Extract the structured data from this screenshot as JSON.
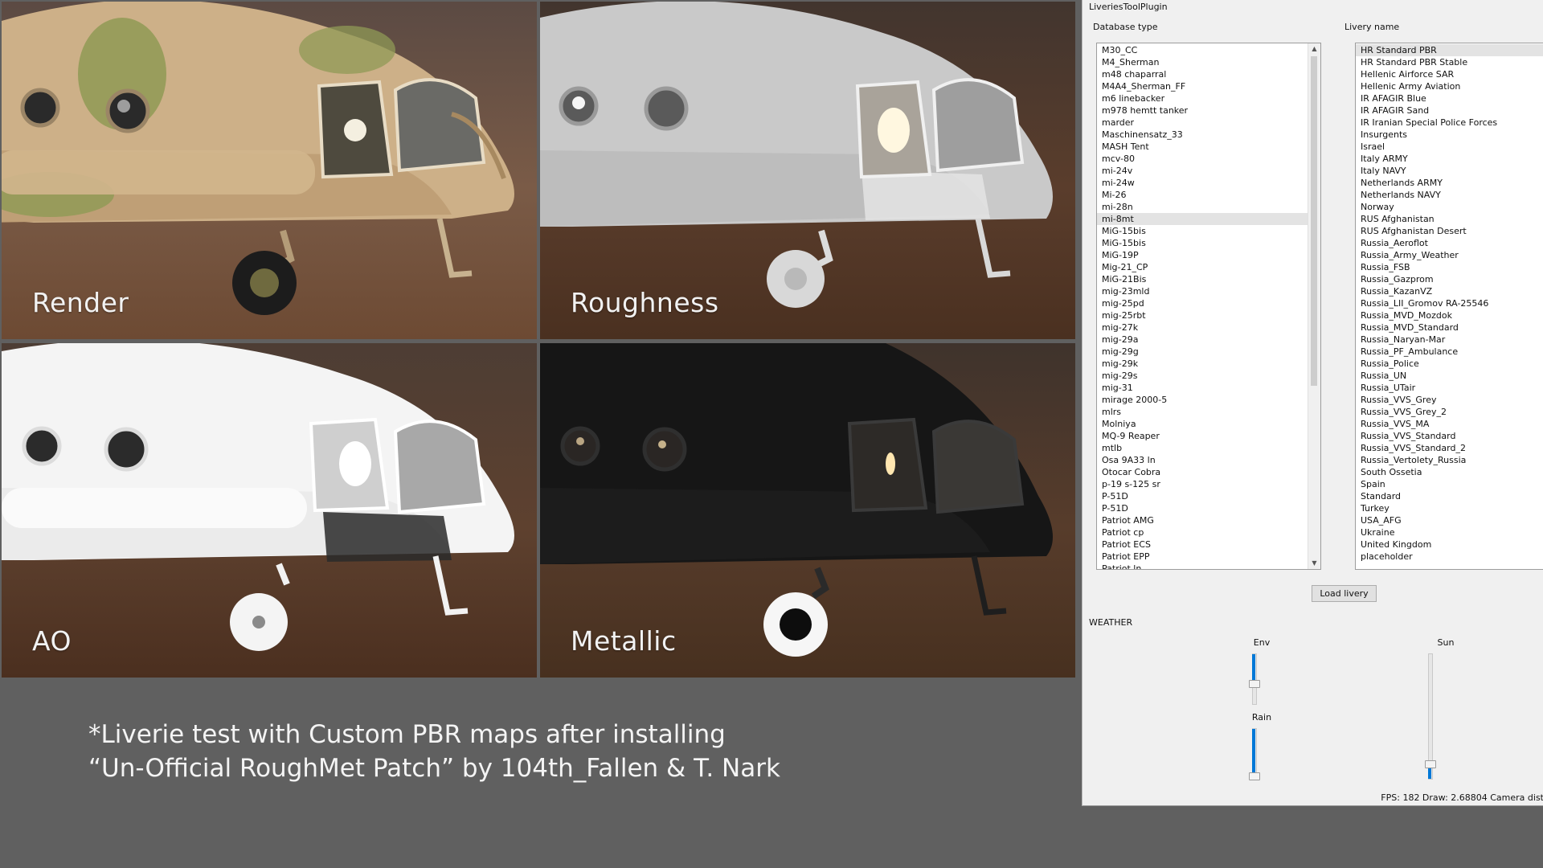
{
  "viewports": [
    {
      "id": "render",
      "label": "Render"
    },
    {
      "id": "roughness",
      "label": "Roughness"
    },
    {
      "id": "ao",
      "label": "AO"
    },
    {
      "id": "metallic",
      "label": "Metallic"
    }
  ],
  "caption": {
    "line1": "*Liverie test with Custom PBR maps after installing",
    "line2": "“Un-Official RoughMet Patch” by 104th_Fallen & T. Nark"
  },
  "plugin": {
    "title": "LiveriesToolPlugin",
    "database_label": "Database type",
    "livery_label": "Livery name",
    "database_items": [
      "M30_CC",
      "M4_Sherman",
      "m48 chaparral",
      "M4A4_Sherman_FF",
      "m6 linebacker",
      "m978 hemtt tanker",
      "marder",
      "Maschinensatz_33",
      "MASH Tent",
      "mcv-80",
      "mi-24v",
      "mi-24w",
      "Mi-26",
      "mi-28n",
      "mi-8mt",
      "MiG-15bis",
      "MiG-15bis",
      "MiG-19P",
      "Mig-21_CP",
      "MiG-21Bis",
      "mig-23mld",
      "mig-25pd",
      "mig-25rbt",
      "mig-27k",
      "mig-29a",
      "mig-29g",
      "mig-29k",
      "mig-29s",
      "mig-31",
      "mirage 2000-5",
      "mlrs",
      "Molniya",
      "MQ-9 Reaper",
      "mtlb",
      "Osa 9A33 ln",
      "Otocar Cobra",
      "p-19 s-125 sr",
      "P-51D",
      "P-51D",
      "Patriot AMG",
      "Patriot cp",
      "Patriot ECS",
      "Patriot EPP",
      "Patriot ln"
    ],
    "database_selected": "mi-8mt",
    "livery_items": [
      "HR Standard PBR",
      "HR Standard PBR Stable",
      "Hellenic Airforce SAR",
      "Hellenic Army Aviation",
      "IR AFAGIR Blue",
      "IR AFAGIR Sand",
      "IR Iranian Special Police Forces",
      "Insurgents",
      "Israel",
      "Italy ARMY",
      "Italy NAVY",
      "Netherlands ARMY",
      "Netherlands NAVY",
      "Norway",
      "RUS Afghanistan",
      "RUS Afghanistan Desert",
      "Russia_Aeroflot",
      "Russia_Army_Weather",
      "Russia_FSB",
      "Russia_Gazprom",
      "Russia_KazanVZ",
      "Russia_LII_Gromov RA-25546",
      "Russia_MVD_Mozdok",
      "Russia_MVD_Standard",
      "Russia_Naryan-Mar",
      "Russia_PF_Ambulance",
      "Russia_Police",
      "Russia_UN",
      "Russia_UTair",
      "Russia_VVS_Grey",
      "Russia_VVS_Grey_2",
      "Russia_VVS_MA",
      "Russia_VVS_Standard",
      "Russia_VVS_Standard_2",
      "Russia_Vertolety_Russia",
      "South Ossetia",
      "Spain",
      "Standard",
      "Turkey",
      "USA_AFG",
      "Ukraine",
      "United Kingdom",
      "placeholder"
    ],
    "livery_selected": "HR Standard PBR",
    "load_button": "Load livery",
    "weather_label": "WEATHER",
    "env_label": "Env",
    "rain_label": "Rain",
    "sun_label": "Sun",
    "env_level": 0.4,
    "rain_level": 0.0,
    "sun_level": 0.1,
    "status": "FPS: 182  Draw: 2.68804  Camera dist",
    "accent_color": "#0078d7"
  }
}
